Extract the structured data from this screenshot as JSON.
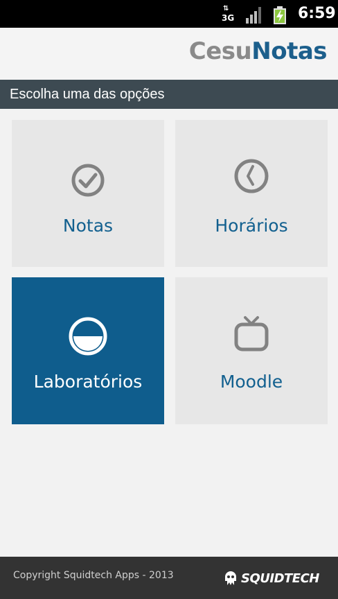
{
  "status_bar": {
    "network_type": "3G",
    "network_arrows": "⇅",
    "time": "6:59",
    "icons": [
      "data-arrows-icon",
      "signal-icon",
      "battery-charging-icon"
    ]
  },
  "app": {
    "logo_part1": "Cesu",
    "logo_part2": "Notas",
    "colors": {
      "brand_blue": "#1c5f8c",
      "logo_gray": "#8a8a8a",
      "subheader": "#3d4a52",
      "tile_bg": "#e7e7e7",
      "tile_active_bg": "#0f5d8d"
    }
  },
  "subheader": {
    "title": "Escolha uma das opções"
  },
  "tiles": [
    {
      "label": "Notas",
      "icon": "check-circle-icon",
      "active": false
    },
    {
      "label": "Horários",
      "icon": "clock-icon",
      "active": false
    },
    {
      "label": "Laboratórios",
      "icon": "half-circle-icon",
      "active": true
    },
    {
      "label": "Moodle",
      "icon": "tv-icon",
      "active": false
    }
  ],
  "footer": {
    "copyright": "Copyright Squidtech Apps - 2013",
    "brand": "SQUIDTECH",
    "brand_icon": "squid-logo-icon"
  }
}
